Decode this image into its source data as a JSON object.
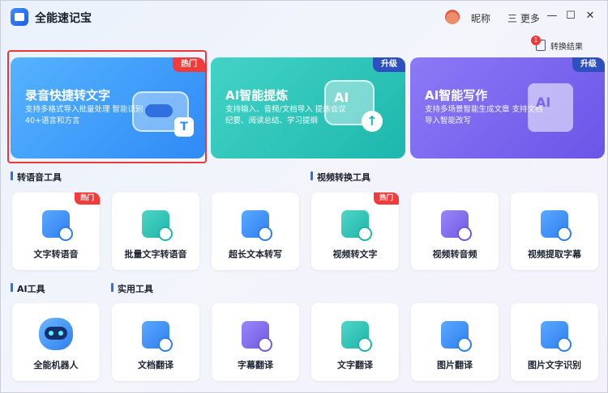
{
  "app": {
    "title": "全能速记宝"
  },
  "titlebar": {
    "nickname": "昵称",
    "more": "三 更多",
    "minimize": "—",
    "maximize": "☐",
    "close": "✕"
  },
  "convert_results": {
    "count": "1",
    "label": "转换结果"
  },
  "banners": [
    {
      "title": "录音快捷转文字",
      "desc": "支持多格式导入批量处理 智能识别40+语言和方言",
      "tag": "热门"
    },
    {
      "title": "AI智能提炼",
      "desc": "支持输入、音频/文档导入 提炼会议纪要、阅读总结、学习提纲",
      "tag": "升级"
    },
    {
      "title": "AI智能写作",
      "desc": "支持多场景智能生成文章 支持文档导入智能改写",
      "tag": "升级"
    }
  ],
  "sections": {
    "speech": "转语音工具",
    "video": "视频转换工具",
    "ai": "AI工具",
    "utility": "实用工具"
  },
  "tiles_row1": [
    {
      "label": "文字转语音",
      "hot": "热门"
    },
    {
      "label": "批量文字转语音"
    },
    {
      "label": "超长文本转写"
    },
    {
      "label": "视频转文字",
      "hot": "热门"
    },
    {
      "label": "视频转音频"
    },
    {
      "label": "视频提取字幕"
    }
  ],
  "tiles_row2": [
    {
      "label": "全能机器人"
    },
    {
      "label": "文档翻译"
    },
    {
      "label": "字幕翻译"
    },
    {
      "label": "文字翻译"
    },
    {
      "label": "图片翻译"
    },
    {
      "label": "图片文字识别"
    }
  ],
  "illustrations": {
    "ai_text": "AI",
    "t_text": "T",
    "up_arrow": "↑"
  }
}
